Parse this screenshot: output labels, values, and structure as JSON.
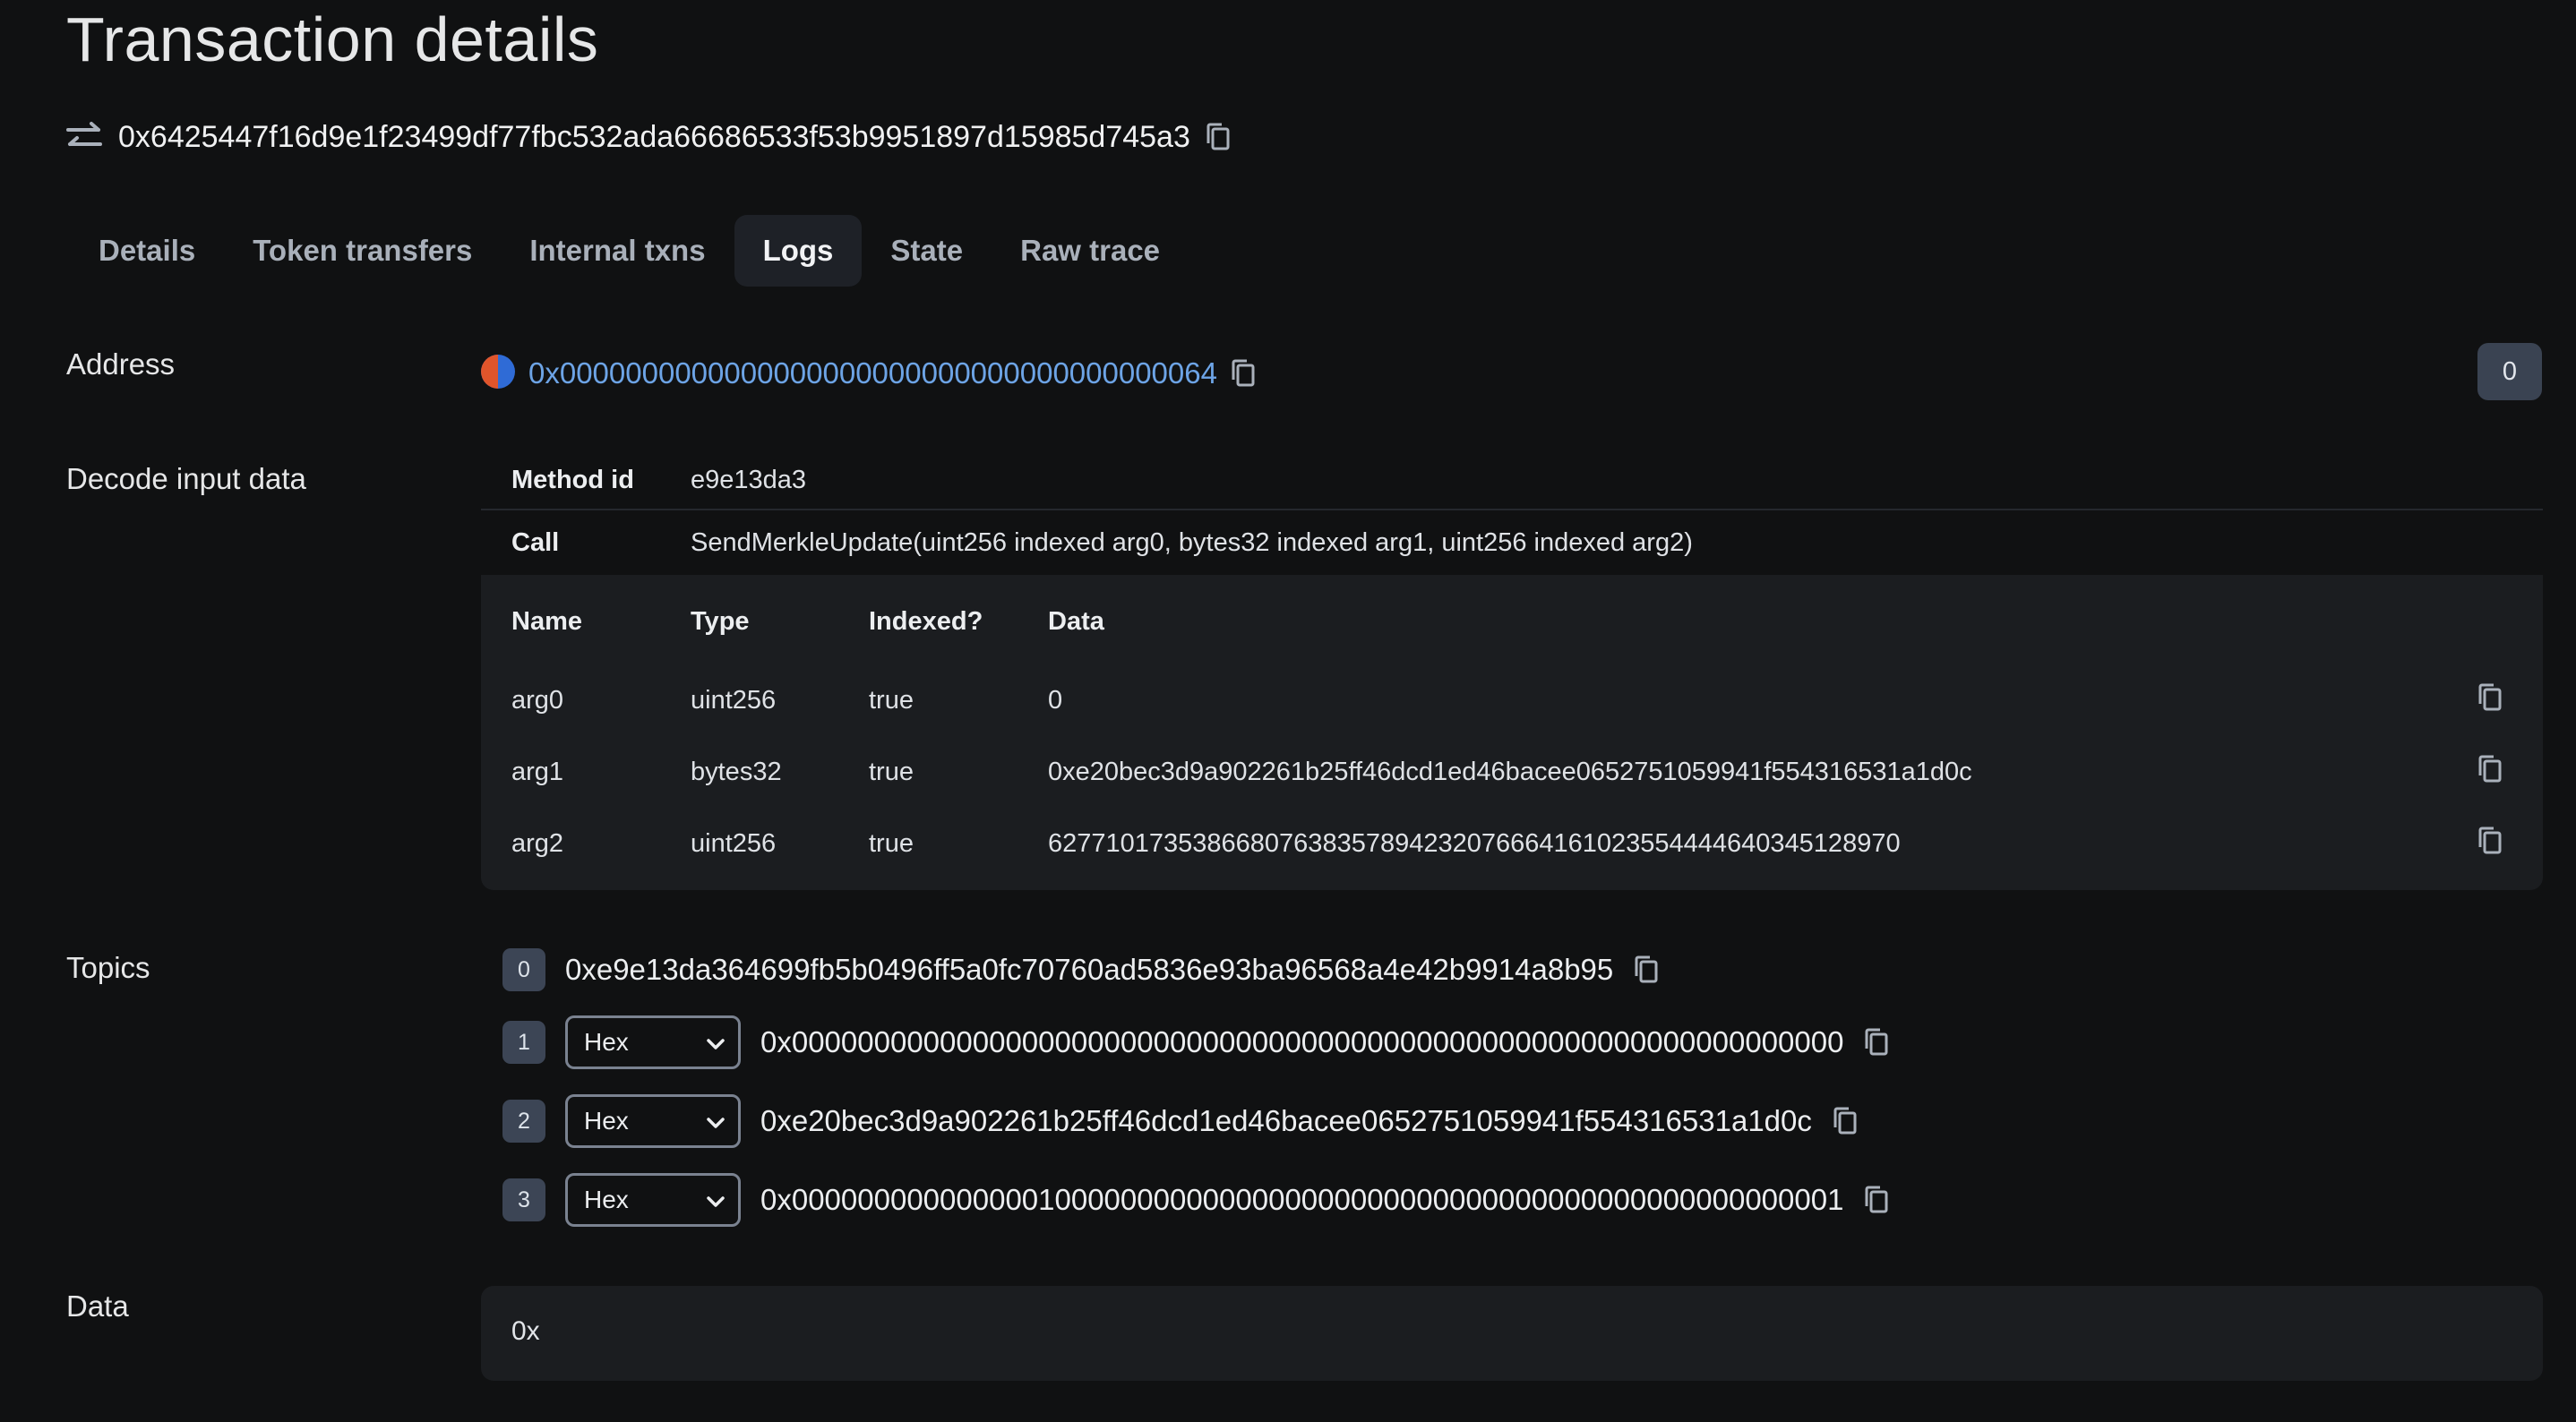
{
  "page": {
    "title": "Transaction details"
  },
  "tx": {
    "hash": "0x6425447f16d9e1f23499df77fbc532ada66686533f53b9951897d15985d745a3"
  },
  "tabs": [
    {
      "label": "Details"
    },
    {
      "label": "Token transfers"
    },
    {
      "label": "Internal txns"
    },
    {
      "label": "Logs"
    },
    {
      "label": "State"
    },
    {
      "label": "Raw trace"
    }
  ],
  "log": {
    "address_label": "Address",
    "address": "0x0000000000000000000000000000000000000064",
    "index_badge": "0",
    "decode_label": "Decode input data",
    "method_id_label": "Method id",
    "method_id": "e9e13da3",
    "call_label": "Call",
    "call": "SendMerkleUpdate(uint256 indexed arg0, bytes32 indexed arg1, uint256 indexed arg2)",
    "args_headers": {
      "name": "Name",
      "type": "Type",
      "indexed": "Indexed?",
      "data": "Data"
    },
    "args": [
      {
        "name": "arg0",
        "type": "uint256",
        "indexed": "true",
        "data": "0"
      },
      {
        "name": "arg1",
        "type": "bytes32",
        "indexed": "true",
        "data": "0xe20bec3d9a902261b25ff46dcd1ed46bacee0652751059941f554316531a1d0c"
      },
      {
        "name": "arg2",
        "type": "uint256",
        "indexed": "true",
        "data": "62771017353866807638357894232076664161023554444640345128970"
      }
    ],
    "topics_label": "Topics",
    "topics": [
      {
        "index": "0",
        "value": "0xe9e13da364699fb5b0496ff5a0fc70760ad5836e93ba96568a4e42b9914a8b95"
      },
      {
        "index": "1",
        "format": "Hex",
        "value": "0x0000000000000000000000000000000000000000000000000000000000000000"
      },
      {
        "index": "2",
        "format": "Hex",
        "value": "0xe20bec3d9a902261b25ff46dcd1ed46bacee0652751059941f554316531a1d0c"
      },
      {
        "index": "3",
        "format": "Hex",
        "value": "0x0000000000000001000000000000000000000000000000000000000000000001"
      }
    ],
    "data_label": "Data",
    "data": "0x"
  },
  "colors": {
    "background": "#101112",
    "link": "#6da4e6",
    "badge": "#3c4555",
    "panel": "#1b1d20"
  }
}
